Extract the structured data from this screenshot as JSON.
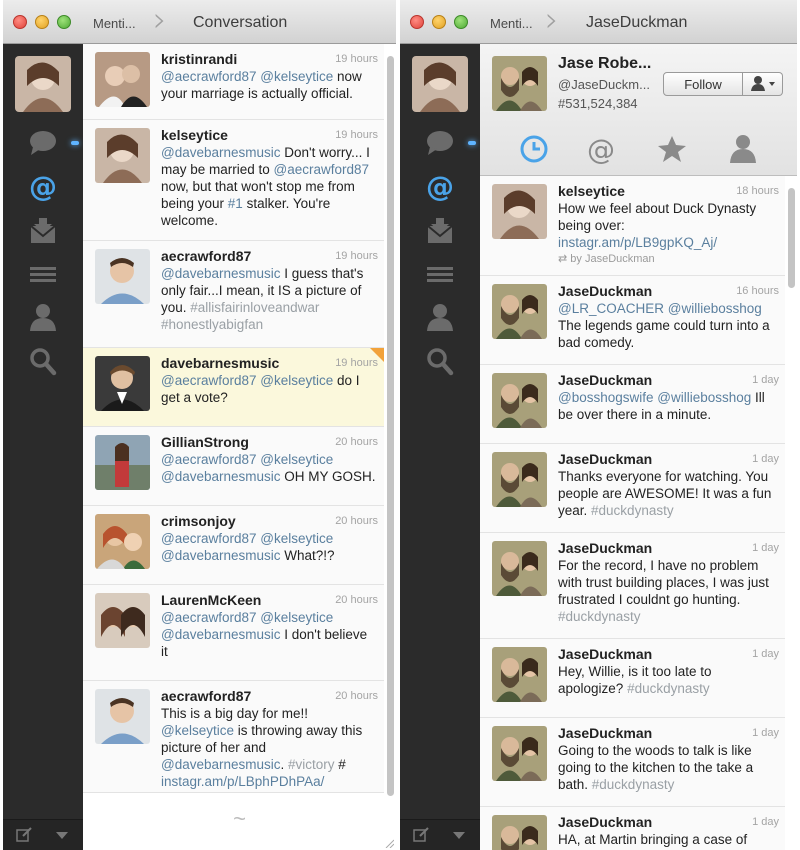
{
  "colors": {
    "sidebar": "#2b2b2b",
    "highlight": "#fbf8dc",
    "mention": "#5a7f9e",
    "hashtag": "#9aa0a5",
    "active_blue": "#4aa3e8"
  },
  "left": {
    "breadcrumb": "Menti...",
    "title": "Conversation",
    "more_glyph": "~",
    "tweets": [
      {
        "user": "kristinrandi",
        "time": "19 hours",
        "parts": [
          {
            "t": "@aecrawford87",
            "k": "m"
          },
          {
            "t": " "
          },
          {
            "t": "@kelseytice",
            "k": "m"
          },
          {
            "t": " now your marriage is actually official."
          }
        ]
      },
      {
        "user": "kelseytice",
        "time": "19 hours",
        "parts": [
          {
            "t": "@davebarnesmusic",
            "k": "m"
          },
          {
            "t": " Don't worry... I may be married to "
          },
          {
            "t": "@aecrawford87",
            "k": "m"
          },
          {
            "t": " now, but that won't stop me from being your "
          },
          {
            "t": "#1",
            "k": "m"
          },
          {
            "t": " stalker. You're welcome."
          }
        ]
      },
      {
        "user": "aecrawford87",
        "time": "19 hours",
        "parts": [
          {
            "t": "@davebarnesmusic",
            "k": "m"
          },
          {
            "t": " I guess that's only fair...I mean, it IS a picture of you. "
          },
          {
            "t": "#allisfairinloveandwar",
            "k": "h"
          },
          {
            "t": " "
          },
          {
            "t": "#honestlyabigfan",
            "k": "h"
          }
        ]
      },
      {
        "user": "davebarnesmusic",
        "time": "19 hours",
        "highlight": true,
        "parts": [
          {
            "t": "@aecrawford87",
            "k": "m"
          },
          {
            "t": " "
          },
          {
            "t": "@kelseytice",
            "k": "m"
          },
          {
            "t": " do I get a vote?"
          }
        ]
      },
      {
        "user": "GillianStrong",
        "time": "20 hours",
        "parts": [
          {
            "t": "@aecrawford87",
            "k": "m"
          },
          {
            "t": " "
          },
          {
            "t": "@kelseytice",
            "k": "m"
          },
          {
            "t": " "
          },
          {
            "t": "@davebarnesmusic",
            "k": "m"
          },
          {
            "t": " OH MY GOSH."
          }
        ]
      },
      {
        "user": "crimsonjoy",
        "time": "20 hours",
        "parts": [
          {
            "t": "@aecrawford87",
            "k": "m"
          },
          {
            "t": " "
          },
          {
            "t": "@kelseytice",
            "k": "m"
          },
          {
            "t": " "
          },
          {
            "t": "@davebarnesmusic",
            "k": "m"
          },
          {
            "t": " What?!?"
          }
        ]
      },
      {
        "user": "LaurenMcKeen",
        "time": "20 hours",
        "parts": [
          {
            "t": "@aecrawford87",
            "k": "m"
          },
          {
            "t": " "
          },
          {
            "t": "@kelseytice",
            "k": "m"
          },
          {
            "t": " "
          },
          {
            "t": "@davebarnesmusic",
            "k": "m"
          },
          {
            "t": " I don't believe it"
          }
        ]
      },
      {
        "user": "aecrawford87",
        "time": "20 hours",
        "parts": [
          {
            "t": "This is a big day for me!! "
          },
          {
            "t": "@kelseytice",
            "k": "m"
          },
          {
            "t": " is throwing away this picture of her and "
          },
          {
            "t": "@davebarnesmusic",
            "k": "m"
          },
          {
            "t": ". "
          },
          {
            "t": "#victory",
            "k": "h"
          },
          {
            "t": " # "
          },
          {
            "t": "instagr.am/p/LBphPDhPAa/",
            "k": "m"
          }
        ]
      }
    ]
  },
  "right": {
    "breadcrumb": "Menti...",
    "title": "JaseDuckman",
    "profile": {
      "name": "Jase Robe...",
      "handle": "@JaseDuckm...",
      "id": "#531,524,384",
      "follow_label": "Follow"
    },
    "tweets": [
      {
        "user": "kelseytice",
        "time": "18 hours",
        "retweet": "by JaseDuckman",
        "parts": [
          {
            "t": "How we feel about Duck Dynasty being over: "
          },
          {
            "t": "instagr.am/p/LB9gpKQ_Aj/",
            "k": "m"
          }
        ]
      },
      {
        "user": "JaseDuckman",
        "time": "16 hours",
        "parts": [
          {
            "t": "@LR_COACHER",
            "k": "m"
          },
          {
            "t": " "
          },
          {
            "t": "@williebosshog",
            "k": "m"
          },
          {
            "t": " The legends game could turn into a bad comedy."
          }
        ]
      },
      {
        "user": "JaseDuckman",
        "time": "1 day",
        "parts": [
          {
            "t": "@bosshogswife",
            "k": "m"
          },
          {
            "t": " "
          },
          {
            "t": "@williebosshog",
            "k": "m"
          },
          {
            "t": " Ill be over there in a minute."
          }
        ]
      },
      {
        "user": "JaseDuckman",
        "time": "1 day",
        "parts": [
          {
            "t": "Thanks everyone for watching. You people are AWESOME!  It was a fun year. "
          },
          {
            "t": "#duckdynasty",
            "k": "h"
          }
        ]
      },
      {
        "user": "JaseDuckman",
        "time": "1 day",
        "parts": [
          {
            "t": "For the record, I have no problem with trust building places, I was just frustrated I couldnt go hunting. "
          },
          {
            "t": "#duckdynasty",
            "k": "h"
          }
        ]
      },
      {
        "user": "JaseDuckman",
        "time": "1 day",
        "parts": [
          {
            "t": "Hey, Willie, is it too late to apologize? "
          },
          {
            "t": "#duckdynasty",
            "k": "h"
          }
        ]
      },
      {
        "user": "JaseDuckman",
        "time": "1 day",
        "parts": [
          {
            "t": "Going to the woods to talk is like going to the kitchen to the take a bath. "
          },
          {
            "t": "#duckdynasty",
            "k": "h"
          }
        ]
      },
      {
        "user": "JaseDuckman",
        "time": "1 day",
        "parts": [
          {
            "t": "HA, at Martin bringing a case of"
          }
        ]
      }
    ]
  }
}
